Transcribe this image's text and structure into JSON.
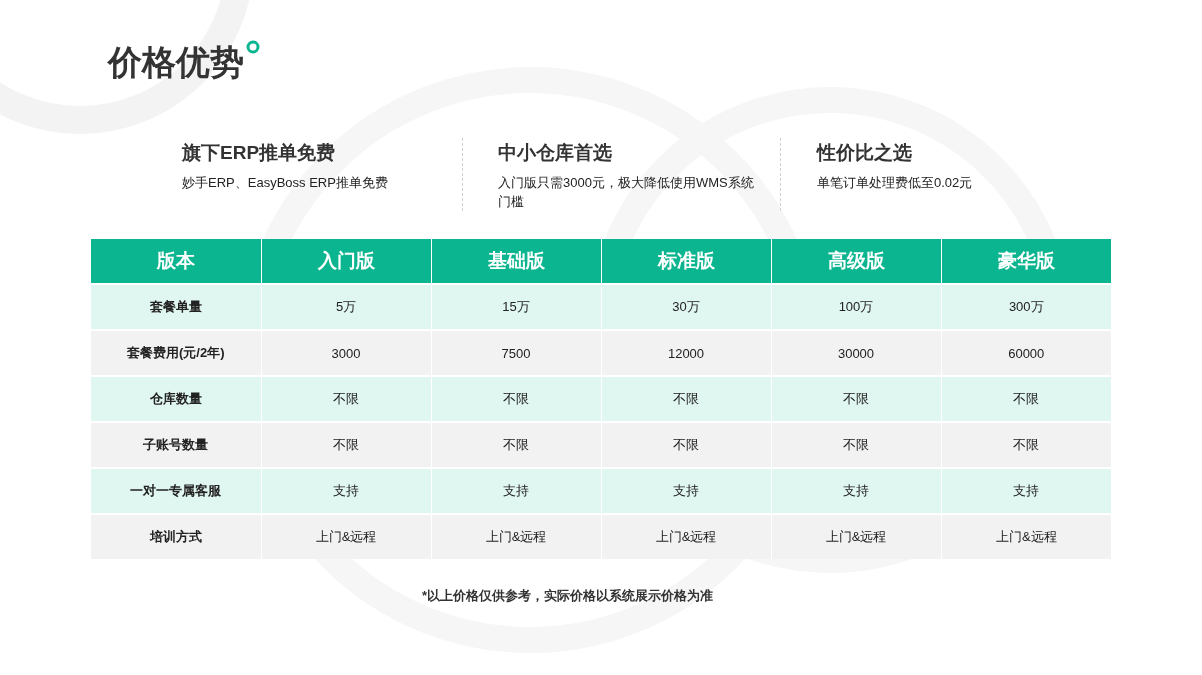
{
  "title": "价格优势",
  "features": [
    {
      "heading": "旗下ERP推单免费",
      "text": "妙手ERP、EasyBoss ERP推单免费"
    },
    {
      "heading": "中小仓库首选",
      "text": "入门版只需3000元，极大降低使用WMS系统门槛"
    },
    {
      "heading": "性价比之选",
      "text": "单笔订单处理费低至0.02元"
    }
  ],
  "table": {
    "columns": [
      "版本",
      "入门版",
      "基础版",
      "标准版",
      "高级版",
      "豪华版"
    ],
    "rows": [
      [
        "套餐单量",
        "5万",
        "15万",
        "30万",
        "100万",
        "300万"
      ],
      [
        "套餐费用(元/2年)",
        "3000",
        "7500",
        "12000",
        "30000",
        "60000"
      ],
      [
        "仓库数量",
        "不限",
        "不限",
        "不限",
        "不限",
        "不限"
      ],
      [
        "子账号数量",
        "不限",
        "不限",
        "不限",
        "不限",
        "不限"
      ],
      [
        "一对一专属客服",
        "支持",
        "支持",
        "支持",
        "支持",
        "支持"
      ],
      [
        "培训方式",
        "上门&远程",
        "上门&远程",
        "上门&远程",
        "上门&远程",
        "上门&远程"
      ]
    ]
  },
  "footnote": "*以上价格仅供参考，实际价格以系统展示价格为准"
}
